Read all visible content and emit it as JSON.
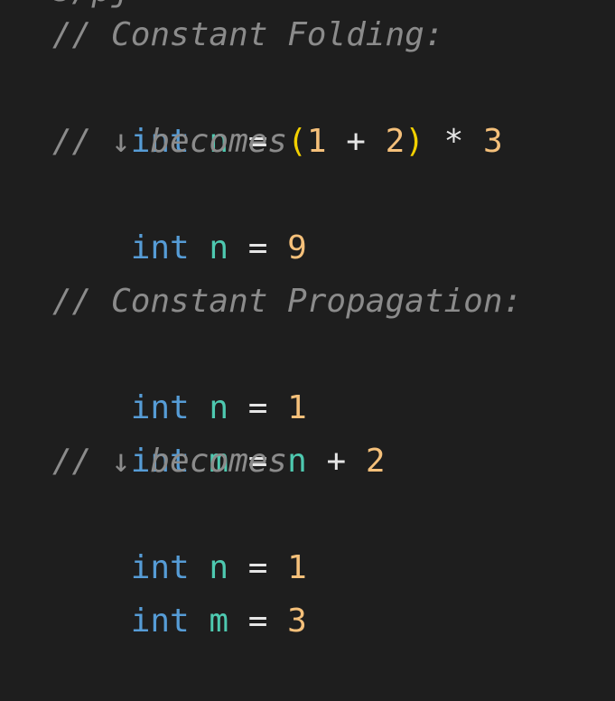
{
  "code": {
    "clipped_top": "s/pj",
    "lines": [
      {
        "comment": "// Constant Folding:"
      },
      {
        "tokens": [
          "int",
          " ",
          "n",
          " ",
          "=",
          " ",
          "(",
          "1",
          " + ",
          "2",
          ")",
          " * ",
          "3"
        ]
      },
      {
        "comment": "// ↓ becomes"
      },
      {
        "tokens": [
          "int",
          " ",
          "n",
          " ",
          "=",
          " ",
          "9"
        ]
      },
      {
        "blank": ""
      },
      {
        "comment": "// Constant Propagation:"
      },
      {
        "tokens": [
          "int",
          " ",
          "n",
          " ",
          "=",
          " ",
          "1"
        ]
      },
      {
        "tokens": [
          "int",
          " ",
          "m",
          " ",
          "=",
          " ",
          "n",
          " + ",
          "2"
        ]
      },
      {
        "comment": "// ↓ becomes"
      },
      {
        "tokens": [
          "int",
          " ",
          "n",
          " ",
          "=",
          " ",
          "1"
        ]
      },
      {
        "tokens": [
          "int",
          " ",
          "m",
          " ",
          "=",
          " ",
          "3"
        ]
      }
    ]
  },
  "colors": {
    "background": "#1e1e1e",
    "keyword": "#569cd6",
    "variable": "#4ec9b0",
    "number": "#f5c07a",
    "operator": "#e6e6e6",
    "paren": "#f2d000",
    "comment": "#8b8b8b"
  }
}
